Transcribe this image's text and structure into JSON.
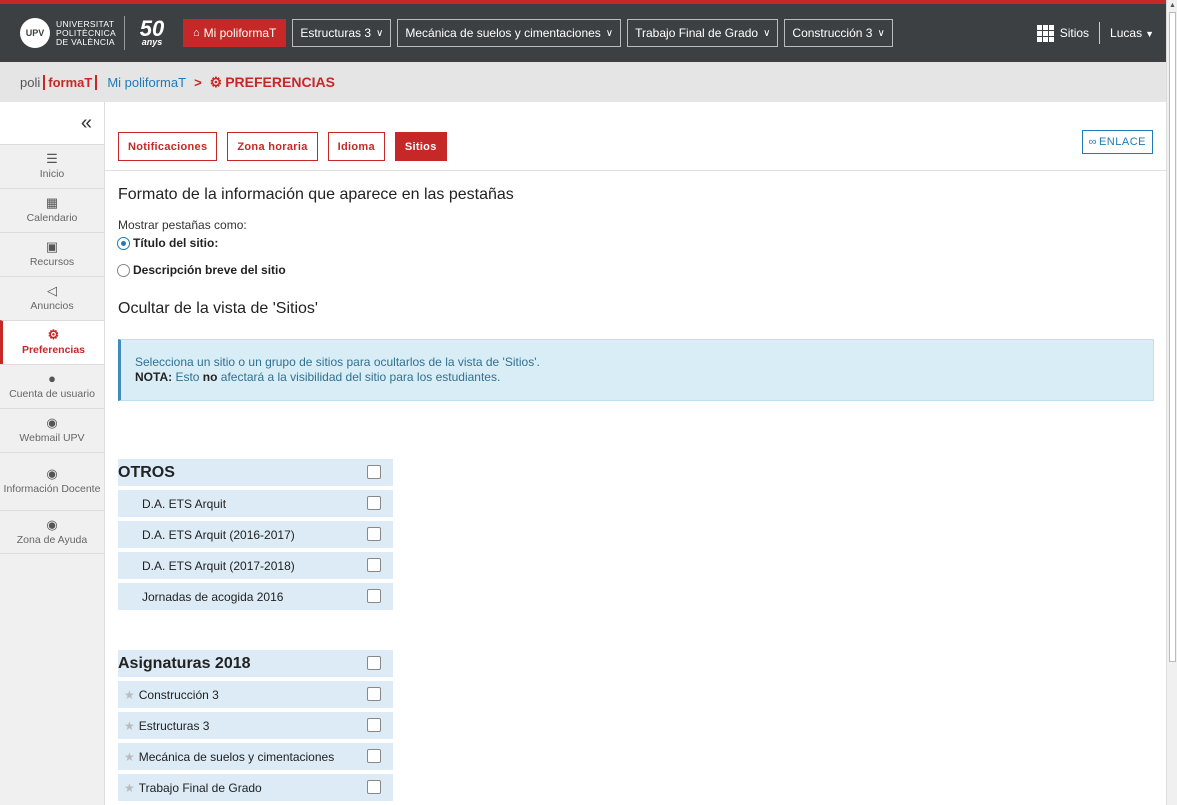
{
  "header": {
    "logo_text": [
      "UNIVERSITAT",
      "POLITÈCNICA",
      "DE VALÈNCIA"
    ],
    "anys_num": "50",
    "anys_label": "anys",
    "home_label": "Mi poliformaT",
    "nav_tabs": [
      "Estructuras 3",
      "Mecánica de suelos y cimentaciones",
      "Trabajo Final de Grado",
      "Construcción 3"
    ],
    "sites_label": "Sitios",
    "user_label": "Lucas"
  },
  "breadcrumb": {
    "poli": "poli",
    "formaT": "formaT",
    "link": "Mi poliformaT",
    "separator": ">",
    "current": "PREFERENCIAS"
  },
  "sidebar": {
    "collapse": "«",
    "items": [
      {
        "label": "Inicio",
        "icon": "list-icon"
      },
      {
        "label": "Calendario",
        "icon": "calendar-icon"
      },
      {
        "label": "Recursos",
        "icon": "folder-icon"
      },
      {
        "label": "Anuncios",
        "icon": "megaphone-icon"
      },
      {
        "label": "Preferencias",
        "icon": "gear-icon"
      },
      {
        "label": "Cuenta de usuario",
        "icon": "user-icon"
      },
      {
        "label": "Webmail UPV",
        "icon": "globe-icon"
      },
      {
        "label": "Información Docente",
        "icon": "globe-icon"
      },
      {
        "label": "Zona de Ayuda",
        "icon": "globe-icon"
      }
    ]
  },
  "tabs": [
    "Notificaciones",
    "Zona horaria",
    "Idioma",
    "Sitios"
  ],
  "enlace_label": "ENLACE",
  "format": {
    "title": "Formato de la información que aparece en las pestañas",
    "show_label": "Mostrar pestañas como:",
    "option_title": "Título del sitio:",
    "option_desc": "Descripción breve del sitio"
  },
  "hide": {
    "title": "Ocultar de la vista de 'Sitios'",
    "info_line1": "Selecciona un sitio o un grupo de sitios para ocultarlos de la vista de 'Sitios'.",
    "info_nota": "NOTA:",
    "info_line2a": " Esto ",
    "info_no": "no",
    "info_line2b": " afectará a la visibilidad del sitio para los estudiantes."
  },
  "groups": [
    {
      "title": "OTROS",
      "items": [
        "D.A. ETS Arquit",
        "D.A. ETS Arquit (2016-2017)",
        "D.A. ETS Arquit (2017-2018)",
        "Jornadas de acogida 2016"
      ]
    },
    {
      "title": "Asignaturas 2018",
      "items": [
        "Construcción 3",
        "Estructuras 3",
        "Mecánica de suelos y cimentaciones",
        "Trabajo Final de Grado"
      ]
    }
  ],
  "colors": {
    "accent": "#c62828",
    "link": "#1c7bb8",
    "topbar": "#3d4043",
    "info_bg": "#d9edf7"
  }
}
